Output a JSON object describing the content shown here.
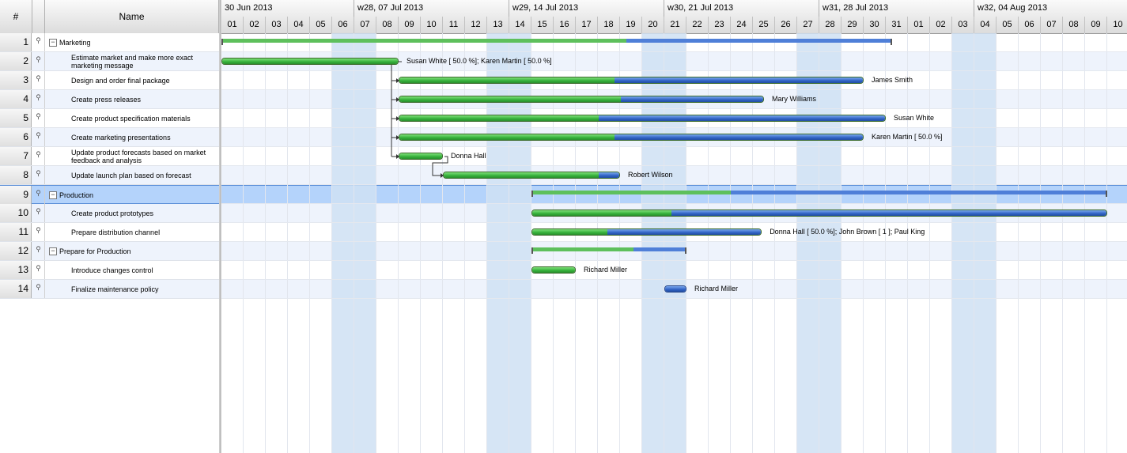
{
  "header": {
    "num_label": "#",
    "name_label": "Name"
  },
  "timeline": {
    "weeks": [
      "30 Jun 2013",
      "w28, 07 Jul 2013",
      "w29, 14 Jul 2013",
      "w30, 21 Jul 2013",
      "w31, 28 Jul 2013",
      "w32, 04 Aug 2013"
    ],
    "days": [
      "01",
      "02",
      "03",
      "04",
      "05",
      "06",
      "07",
      "08",
      "09",
      "10",
      "11",
      "12",
      "13",
      "14",
      "15",
      "16",
      "17",
      "18",
      "19",
      "20",
      "21",
      "22",
      "23",
      "24",
      "25",
      "26",
      "27",
      "28",
      "29",
      "30",
      "31",
      "01",
      "02",
      "03",
      "04",
      "05",
      "06",
      "07",
      "08",
      "09",
      "10"
    ]
  },
  "colors": {
    "complete": "#35b03a",
    "remaining": "#2f62c4",
    "weekend": "#cfe0f3",
    "selected_row": "#b4d3fb"
  },
  "tasks": [
    {
      "num": "1",
      "name": "Marketing",
      "summary": true,
      "level": 0,
      "start": 1,
      "end": 31.3,
      "complete_to": 19.3,
      "resources": ""
    },
    {
      "num": "2",
      "name": "Estimate market and make more exact marketing message",
      "summary": false,
      "level": 1,
      "start": 1,
      "end": 9,
      "complete_to": 9,
      "resources": "Susan White [ 50.0 %]; Karen Martin [ 50.0 %]"
    },
    {
      "num": "3",
      "name": "Design and order final package",
      "summary": false,
      "level": 1,
      "start": 9,
      "end": 30,
      "complete_to": 18.7,
      "resources": "James Smith"
    },
    {
      "num": "4",
      "name": "Create press releases",
      "summary": false,
      "level": 1,
      "start": 9,
      "end": 25.5,
      "complete_to": 19,
      "resources": "Mary Williams"
    },
    {
      "num": "5",
      "name": "Create product specification materials",
      "summary": false,
      "level": 1,
      "start": 9,
      "end": 31,
      "complete_to": 18,
      "resources": "Susan White"
    },
    {
      "num": "6",
      "name": "Create marketing presentations",
      "summary": false,
      "level": 1,
      "start": 9,
      "end": 30,
      "complete_to": 18.7,
      "resources": "Karen Martin [ 50.0 %]"
    },
    {
      "num": "7",
      "name": "Update product forecasts based on market feedback and analysis",
      "summary": false,
      "level": 1,
      "start": 9,
      "end": 11,
      "complete_to": 11,
      "resources": "Donna Hall"
    },
    {
      "num": "8",
      "name": "Update launch plan based on forecast",
      "summary": false,
      "level": 1,
      "start": 11,
      "end": 19,
      "complete_to": 18,
      "resources": "Robert Wilson"
    },
    {
      "num": "9",
      "name": "Production",
      "summary": true,
      "level": 0,
      "selected": true,
      "start": 15,
      "end": 41,
      "complete_to": 24,
      "resources": ""
    },
    {
      "num": "10",
      "name": "Create product prototypes",
      "summary": false,
      "level": 1,
      "start": 15,
      "end": 41,
      "complete_to": 21.3,
      "resources": ""
    },
    {
      "num": "11",
      "name": "Prepare distribution channel",
      "summary": false,
      "level": 1,
      "start": 15,
      "end": 25.4,
      "complete_to": 18.4,
      "resources": "Donna Hall [ 50.0 %]; John Brown [ 1 ]; Paul King"
    },
    {
      "num": "12",
      "name": "Prepare for Production",
      "summary": true,
      "level": 0,
      "start": 15,
      "end": 22,
      "complete_to": 19.6,
      "resources": ""
    },
    {
      "num": "13",
      "name": "Introduce changes control",
      "summary": false,
      "level": 1,
      "start": 15,
      "end": 17,
      "complete_to": 17,
      "resources": "Richard Miller"
    },
    {
      "num": "14",
      "name": "Finalize maintenance policy",
      "summary": false,
      "level": 1,
      "start": 21,
      "end": 22,
      "complete_to": 21,
      "resources": "Richard Miller"
    }
  ]
}
